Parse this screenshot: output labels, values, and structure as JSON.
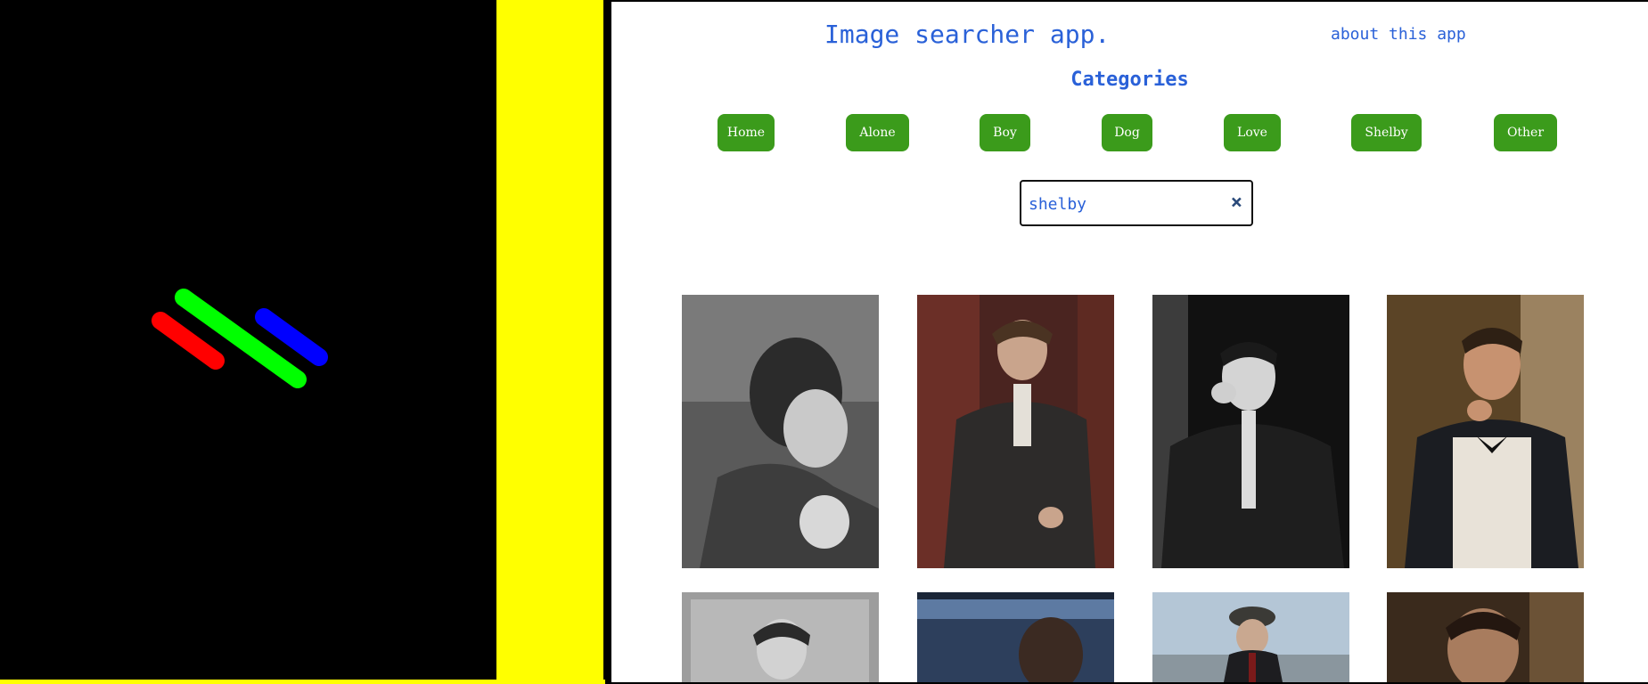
{
  "app": {
    "title": "Image searcher app.",
    "about_label": "about this app",
    "categories_heading": "Categories"
  },
  "categories": [
    "Home",
    "Alone",
    "Boy",
    "Dog",
    "Love",
    "Shelby",
    "Other"
  ],
  "search": {
    "value": "shelby",
    "clear_icon": "×"
  },
  "colors": {
    "accent_blue": "#2a61d8",
    "button_green": "#3b9b1b",
    "yellow_strip": "#ffff00",
    "logo_red": "#ff0000",
    "logo_green": "#00ff00",
    "logo_blue": "#0000ff"
  },
  "icons": [
    "logo-stripes-icon",
    "close-icon"
  ]
}
